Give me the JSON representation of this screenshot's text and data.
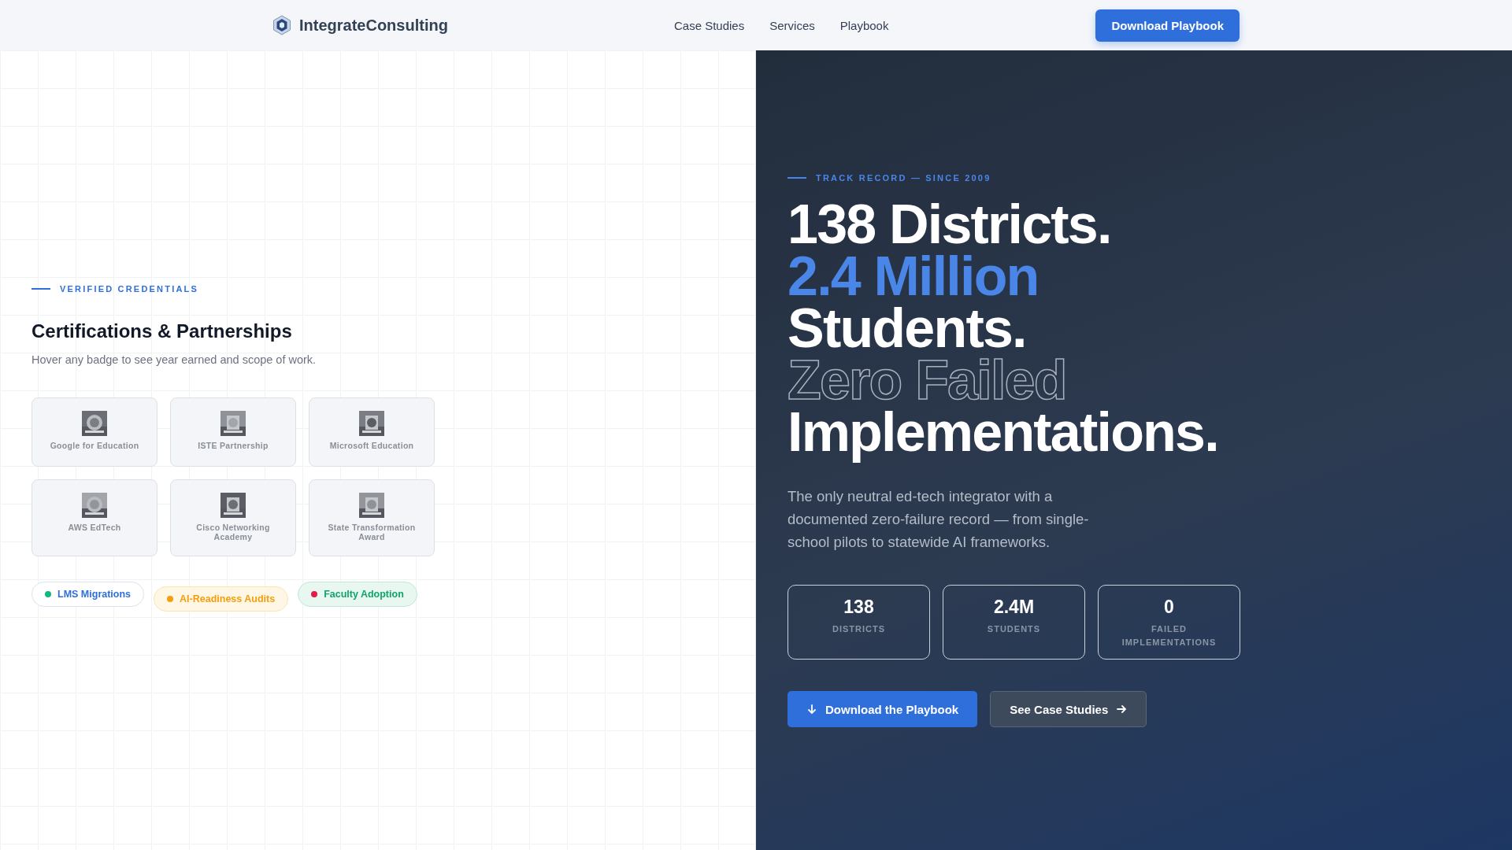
{
  "header": {
    "brand": "IntegrateConsulting",
    "nav": [
      {
        "label": "Case Studies"
      },
      {
        "label": "Services"
      },
      {
        "label": "Playbook"
      }
    ],
    "cta": "Download Playbook"
  },
  "credentials": {
    "eyebrow": "VERIFIED CREDENTIALS",
    "title": "Certifications & Partnerships",
    "subtitle": "Hover any badge to see year earned and scope of work.",
    "badges": [
      {
        "label": "Google for Education",
        "kind": "picture"
      },
      {
        "label": "ISTE Partnership",
        "kind": "picture"
      },
      {
        "label": "Microsoft Education",
        "kind": "picture"
      },
      {
        "label": "AWS EdTech",
        "kind": "picture"
      },
      {
        "label": "Cisco Networking Academy",
        "kind": "picture"
      },
      {
        "label": "State Transformation Award",
        "kind": "picture"
      }
    ],
    "tags": [
      {
        "label": "LMS Migrations",
        "kind": "outline",
        "color": "#10b981"
      },
      {
        "label": "AI-Readiness Audits",
        "kind": "warning",
        "color": "#f59e0b"
      },
      {
        "label": "Faculty Adoption",
        "kind": "success",
        "color": "#e11d48"
      }
    ]
  },
  "hero": {
    "eyebrow": "TRACK RECORD — SINCE 2009",
    "headline": [
      {
        "text": "138 Districts.",
        "kind": "solid"
      },
      {
        "text": "2.4 Million",
        "kind": "accent"
      },
      {
        "text": "Students.",
        "kind": "solid"
      },
      {
        "text": "Zero Failed",
        "kind": "outline"
      },
      {
        "text": "Implementations.",
        "kind": "solid"
      }
    ],
    "description": "The only neutral ed-tech integrator with a documented zero-failure record — from single-school pilots to statewide AI frameworks.",
    "stats": [
      {
        "value": "138",
        "label": "DISTRICTS"
      },
      {
        "value": "2.4M",
        "label": "STUDENTS"
      },
      {
        "value": "0",
        "label": "FAILED IMPLEMENTATIONS"
      }
    ],
    "primary_button": "Download the Playbook",
    "secondary_button": "See Case Studies"
  }
}
